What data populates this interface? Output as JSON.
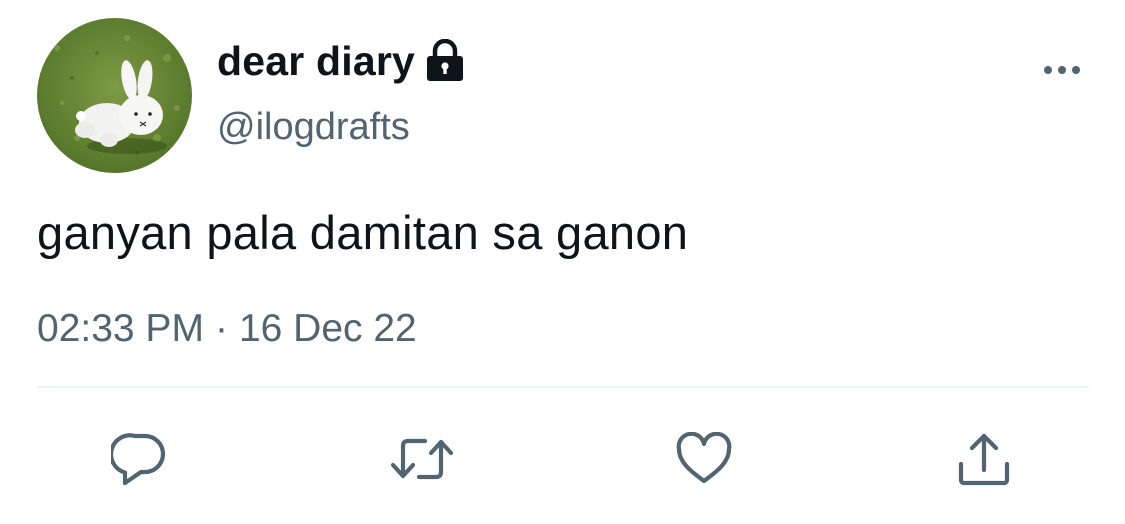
{
  "tweet": {
    "author": {
      "display_name": "dear diary",
      "handle": "@ilogdrafts",
      "protected_icon": "lock-icon",
      "avatar_icon": "bunny-on-grass-avatar"
    },
    "text": "ganyan pala damitan sa ganon",
    "time": "02:33 PM",
    "separator": "·",
    "date": "16 Dec 22",
    "more_icon": "more-dots-icon",
    "actions": [
      {
        "name": "reply",
        "icon": "reply-icon"
      },
      {
        "name": "retweet",
        "icon": "retweet-icon"
      },
      {
        "name": "like",
        "icon": "heart-icon"
      },
      {
        "name": "share",
        "icon": "share-icon"
      }
    ]
  },
  "colors": {
    "text_primary": "#0f1419",
    "text_secondary": "#536471",
    "divider": "#eff3f4",
    "icon": "#536471"
  }
}
